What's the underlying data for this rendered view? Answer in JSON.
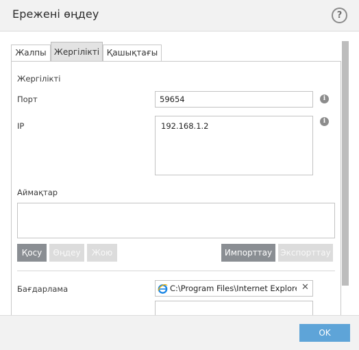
{
  "window": {
    "title": "Ережені өңдеу",
    "help_symbol": "?"
  },
  "tabs": [
    {
      "label": "Жалпы",
      "active": false
    },
    {
      "label": "Жергілікті",
      "active": true
    },
    {
      "label": "Қашықтағы",
      "active": false
    }
  ],
  "local": {
    "section_title": "Жергілікті",
    "port_label": "Порт",
    "port_value": "59654",
    "ip_label": "IP",
    "ip_value": "192.168.1.2",
    "info_symbol": "i",
    "zones_label": "Аймақтар"
  },
  "zone_buttons": {
    "add": "Қосу",
    "edit": "Өңдеу",
    "delete": "Жою",
    "import": "Импорттау",
    "export": "Экспорттау"
  },
  "program": {
    "label": "Бағдарлама",
    "value": "C:\\Program Files\\Internet Explorer\\",
    "clear_symbol": "✕"
  },
  "footer": {
    "ok_label": "OK"
  },
  "colors": {
    "ok_button": "#5ea4d8",
    "primary_button": "#8a8e93",
    "disabled_button": "#dcdcdc",
    "info_icon": "#8c8c8c"
  }
}
